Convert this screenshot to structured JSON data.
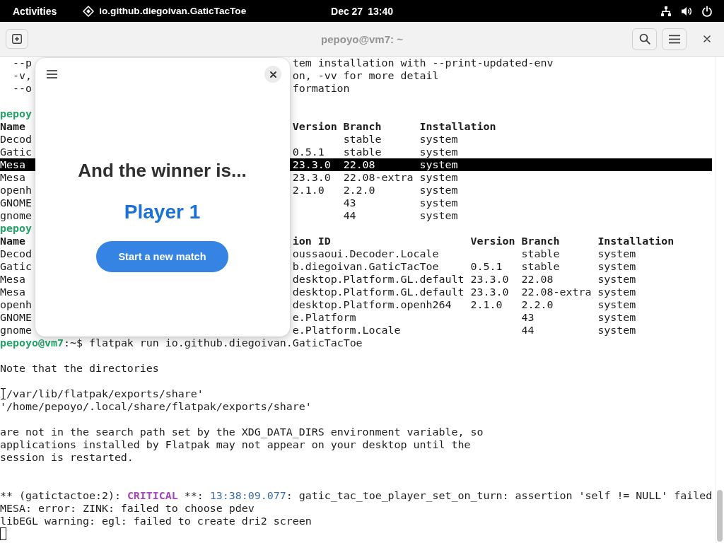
{
  "top_bar": {
    "activities": "Activities",
    "app_menu": "io.github.diegoivan.GaticTacToe",
    "clock": "Dec 27 13:40"
  },
  "terminal": {
    "title": "pepoyo@vm7: ~",
    "lines": [
      {
        "selected": false,
        "left": {
          "kind": "plain",
          "text": "  --p"
        },
        "right": {
          "kind": "plain",
          "text": "tem installation with --print-updated-env"
        }
      },
      {
        "selected": false,
        "left": {
          "kind": "plain",
          "text": "  -v,"
        },
        "right": {
          "kind": "plain",
          "text": "on, -vv for more detail"
        }
      },
      {
        "selected": false,
        "left": {
          "kind": "plain",
          "text": "  --o"
        },
        "right": {
          "kind": "plain",
          "text": "formation"
        }
      },
      {
        "selected": false
      },
      {
        "selected": false,
        "left": {
          "kind": "prompt",
          "text": "pepoy"
        }
      },
      {
        "selected": false,
        "left": {
          "kind": "bold",
          "text": "Name"
        },
        "right": {
          "kind": "bold",
          "text": "Version Branch      Installation"
        }
      },
      {
        "selected": false,
        "left": {
          "kind": "plain",
          "text": "Decod"
        },
        "right": {
          "kind": "plain",
          "text": "        stable      system"
        }
      },
      {
        "selected": false,
        "left": {
          "kind": "plain",
          "text": "Gatic"
        },
        "right": {
          "kind": "plain",
          "text": "0.5.1   stable      system"
        }
      },
      {
        "selected": true,
        "left": {
          "kind": "plain",
          "text": "Mesa"
        },
        "right": {
          "kind": "plain",
          "text": "23.3.0  22.08       system"
        }
      },
      {
        "selected": false,
        "left": {
          "kind": "plain",
          "text": "Mesa"
        },
        "right": {
          "kind": "plain",
          "text": "23.3.0  22.08-extra system"
        }
      },
      {
        "selected": false,
        "left": {
          "kind": "plain",
          "text": "openh"
        },
        "right": {
          "kind": "plain",
          "text": "2.1.0   2.2.0       system"
        }
      },
      {
        "selected": false,
        "left": {
          "kind": "plain",
          "text": "GNOME"
        },
        "right": {
          "kind": "plain",
          "text": "        43          system"
        }
      },
      {
        "selected": false,
        "left": {
          "kind": "plain",
          "text": "gnome"
        },
        "right": {
          "kind": "plain",
          "text": "        44          system"
        }
      },
      {
        "selected": false,
        "left": {
          "kind": "prompt",
          "text": "pepoy"
        }
      },
      {
        "selected": false,
        "left": {
          "kind": "bold",
          "text": "Name"
        },
        "right": {
          "kind": "bold",
          "text": "ion ID                      Version Branch      Installation"
        }
      },
      {
        "selected": false,
        "left": {
          "kind": "plain",
          "text": "Decod"
        },
        "right": {
          "kind": "plain",
          "text": "oussaoui.Decoder.Locale             stable      system"
        }
      },
      {
        "selected": false,
        "left": {
          "kind": "plain",
          "text": "Gatic"
        },
        "right": {
          "kind": "plain",
          "text": "b.diegoivan.GaticTacToe     0.5.1   stable      system"
        }
      },
      {
        "selected": false,
        "left": {
          "kind": "plain",
          "text": "Mesa"
        },
        "right": {
          "kind": "plain",
          "text": "desktop.Platform.GL.default 23.3.0  22.08       system"
        }
      },
      {
        "selected": false,
        "left": {
          "kind": "plain",
          "text": "Mesa"
        },
        "right": {
          "kind": "plain",
          "text": "desktop.Platform.GL.default 23.3.0  22.08-extra system"
        }
      },
      {
        "selected": false,
        "left": {
          "kind": "plain",
          "text": "openh"
        },
        "right": {
          "kind": "plain",
          "text": "desktop.Platform.openh264   2.1.0   2.2.0       system"
        }
      },
      {
        "selected": false,
        "left": {
          "kind": "plain",
          "text": "GNOME"
        },
        "right": {
          "kind": "plain",
          "text": "e.Platform                          43          system"
        }
      },
      {
        "selected": false,
        "left": {
          "kind": "plain",
          "text": "gnome"
        },
        "right": {
          "kind": "plain",
          "text": "e.Platform.Locale                   44          system"
        }
      },
      {
        "selected": false,
        "parts": [
          {
            "kind": "prompt",
            "text": "pepoyo@vm7"
          },
          {
            "kind": "plain",
            "text": ":~$ flatpak run io.github.diegoivan.GaticTacToe"
          }
        ]
      },
      {
        "selected": false
      },
      {
        "selected": false,
        "parts": [
          {
            "kind": "plain",
            "text": "Note that the directories"
          }
        ]
      },
      {
        "selected": false
      },
      {
        "selected": false,
        "parts": [
          {
            "kind": "pointer"
          },
          {
            "kind": "plain",
            "text": "/var/lib/flatpak/exports/share'"
          }
        ]
      },
      {
        "selected": false,
        "parts": [
          {
            "kind": "plain",
            "text": "'/home/pepoyo/.local/share/flatpak/exports/share'"
          }
        ]
      },
      {
        "selected": false
      },
      {
        "selected": false,
        "parts": [
          {
            "kind": "plain",
            "text": "are not in the search path set by the XDG_DATA_DIRS environment variable, so"
          }
        ]
      },
      {
        "selected": false,
        "parts": [
          {
            "kind": "plain",
            "text": "applications installed by Flatpak may not appear on your desktop until the"
          }
        ]
      },
      {
        "selected": false,
        "parts": [
          {
            "kind": "plain",
            "text": "session is restarted."
          }
        ]
      },
      {
        "selected": false
      },
      {
        "selected": false
      },
      {
        "selected": false,
        "parts": [
          {
            "kind": "plain",
            "text": "** (gatictactoe:2): "
          },
          {
            "kind": "critical",
            "text": "CRITICAL"
          },
          {
            "kind": "plain",
            "text": " **: "
          },
          {
            "kind": "time",
            "text": "13:38:09.077"
          },
          {
            "kind": "plain",
            "text": ": gatic_tac_toe_player_set_on_turn: assertion 'self != NULL' failed"
          }
        ]
      },
      {
        "selected": false,
        "parts": [
          {
            "kind": "plain",
            "text": "MESA: error: ZINK: failed to choose pdev"
          }
        ]
      },
      {
        "selected": false,
        "parts": [
          {
            "kind": "plain",
            "text": "libEGL warning: egl: failed to create dri2 screen"
          }
        ]
      },
      {
        "selected": false,
        "parts": [
          {
            "kind": "cursor"
          }
        ]
      }
    ]
  },
  "dialog": {
    "heading": "And the winner is...",
    "winner": "Player 1",
    "button": "Start a new match"
  }
}
